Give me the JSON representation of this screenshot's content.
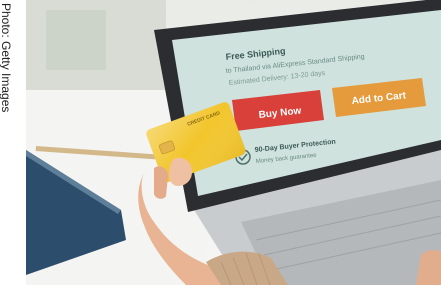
{
  "credit": "Photo: Getty Images",
  "screen": {
    "shipping_title": "Free Shipping",
    "shipping_line": "to Thailand via AliExpress Standard Shipping",
    "delivery_line": "Estimated Delivery: 13-20 days",
    "buy_now_label": "Buy Now",
    "add_to_cart_label": "Add to Cart",
    "protection_title": "90-Day Buyer Protection",
    "protection_sub": "Money back guarantee"
  },
  "card": {
    "label": "CREDIT CARD"
  },
  "colors": {
    "screen_bg": "#cfe2dd",
    "buy_now": "#d9403a",
    "add_to_cart": "#e59a3b",
    "card": "#f2c52b"
  }
}
